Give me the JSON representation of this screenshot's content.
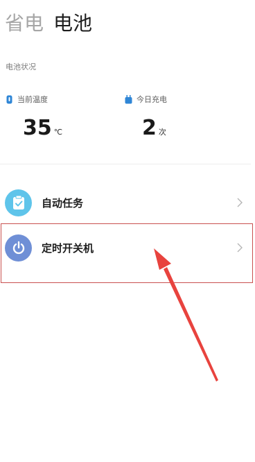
{
  "tabs": [
    {
      "label": "省电"
    },
    {
      "label": "电池"
    }
  ],
  "battery_status": {
    "title": "电池状况",
    "temperature": {
      "label": "当前温度",
      "value": "35",
      "unit": "℃"
    },
    "charges_today": {
      "label": "今日充电",
      "value": "2",
      "unit": "次"
    }
  },
  "list": [
    {
      "label": "自动任务",
      "icon": "clipboard-check-icon",
      "icon_bg": "#5ec4ea"
    },
    {
      "label": "定时开关机",
      "icon": "power-icon",
      "icon_bg": "#6f8fd6"
    }
  ],
  "annotation": {
    "color": "#e8433e"
  }
}
